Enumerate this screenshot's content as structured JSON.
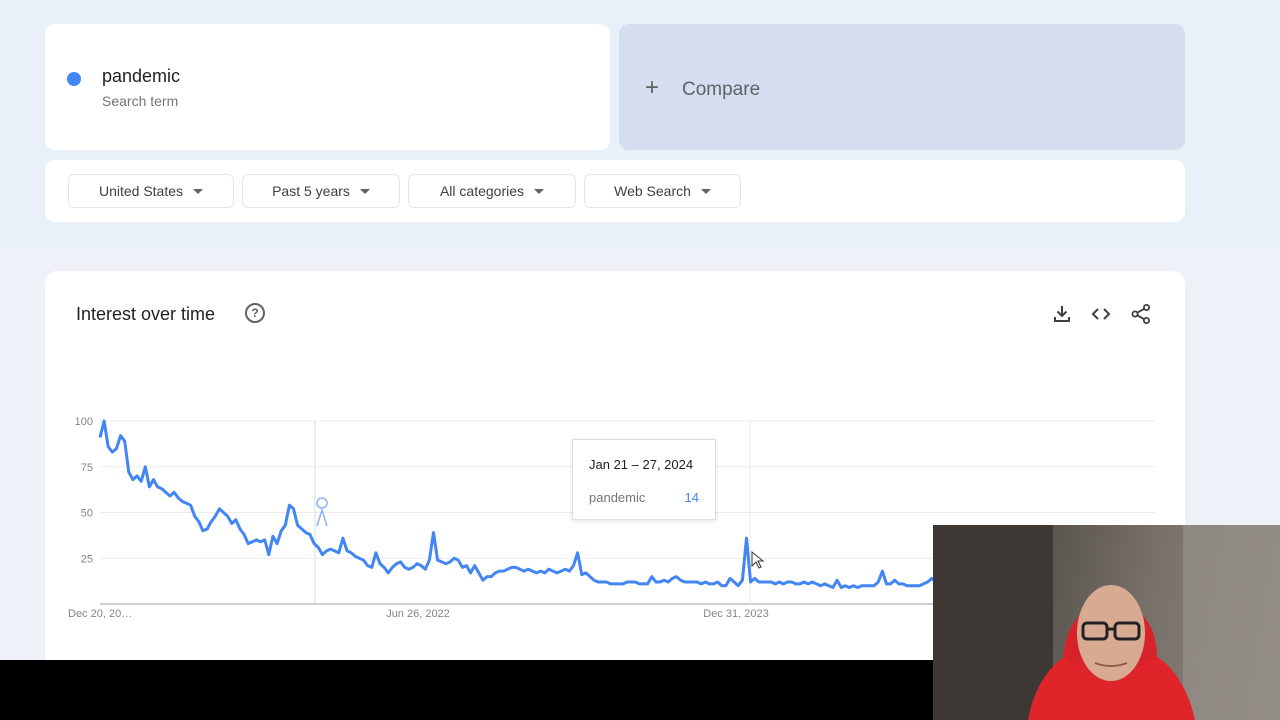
{
  "search_term": {
    "name": "pandemic",
    "subtitle": "Search term",
    "color": "#4285f4"
  },
  "compare": {
    "label": "Compare",
    "icon": "plus-icon"
  },
  "filters": {
    "region": "United States",
    "time": "Past 5 years",
    "category": "All categories",
    "search_type": "Web Search"
  },
  "panel": {
    "title": "Interest over time",
    "help_icon": "help-circle-icon",
    "tools": [
      "download-icon",
      "embed-code-icon",
      "share-icon"
    ]
  },
  "tooltip": {
    "date": "Jan 21 – 27, 2024",
    "term": "pandemic",
    "value": "14"
  },
  "chart_data": {
    "type": "line",
    "ylim": [
      0,
      100
    ],
    "yticks": [
      "100",
      "75",
      "50",
      "25"
    ],
    "xtick_labels": [
      "Dec 20, 20…",
      "Jun 26, 2022",
      "Dec 31, 2023"
    ],
    "grid": true,
    "series": [
      {
        "name": "pandemic",
        "color": "#4285f4",
        "values": [
          91,
          100,
          86,
          83,
          85,
          92,
          89,
          72,
          68,
          70,
          67,
          75,
          64,
          68,
          64,
          63,
          61,
          59,
          61,
          58,
          56,
          55,
          54,
          48,
          45,
          40,
          41,
          45,
          48,
          52,
          50,
          48,
          44,
          46,
          41,
          38,
          33,
          34,
          35,
          34,
          35,
          27,
          37,
          33,
          40,
          43,
          54,
          52,
          43,
          41,
          39,
          38,
          33,
          31,
          27,
          29,
          30,
          29,
          28,
          36,
          29,
          28,
          26,
          25,
          24,
          21,
          20,
          28,
          22,
          20,
          17,
          20,
          22,
          23,
          20,
          19,
          20,
          22,
          21,
          19,
          24,
          39,
          24,
          23,
          22,
          23,
          25,
          24,
          20,
          21,
          17,
          21,
          17,
          13,
          15,
          15,
          17,
          18,
          18,
          19,
          20,
          20,
          19,
          18,
          19,
          18,
          17,
          18,
          17,
          19,
          18,
          17,
          18,
          19,
          18,
          21,
          28,
          16,
          17,
          15,
          13,
          12,
          12,
          12,
          11,
          11,
          11,
          11,
          12,
          12,
          12,
          11,
          11,
          11,
          15,
          12,
          12,
          13,
          12,
          14,
          15,
          13,
          12,
          12,
          12,
          12,
          11,
          12,
          11,
          11,
          12,
          10,
          10,
          14,
          12,
          10,
          13,
          36,
          12,
          14,
          12,
          12,
          12,
          12,
          11,
          12,
          11,
          12,
          12,
          11,
          11,
          12,
          11,
          12,
          11,
          10,
          11,
          10,
          9,
          13,
          9,
          10,
          9,
          10,
          9,
          10,
          10,
          10,
          10,
          12,
          18,
          11,
          11,
          13,
          11,
          11,
          10,
          10,
          10,
          10,
          11,
          12,
          14,
          12,
          10
        ]
      }
    ]
  },
  "webcam": {
    "description": "presenter-webcam-feed"
  }
}
